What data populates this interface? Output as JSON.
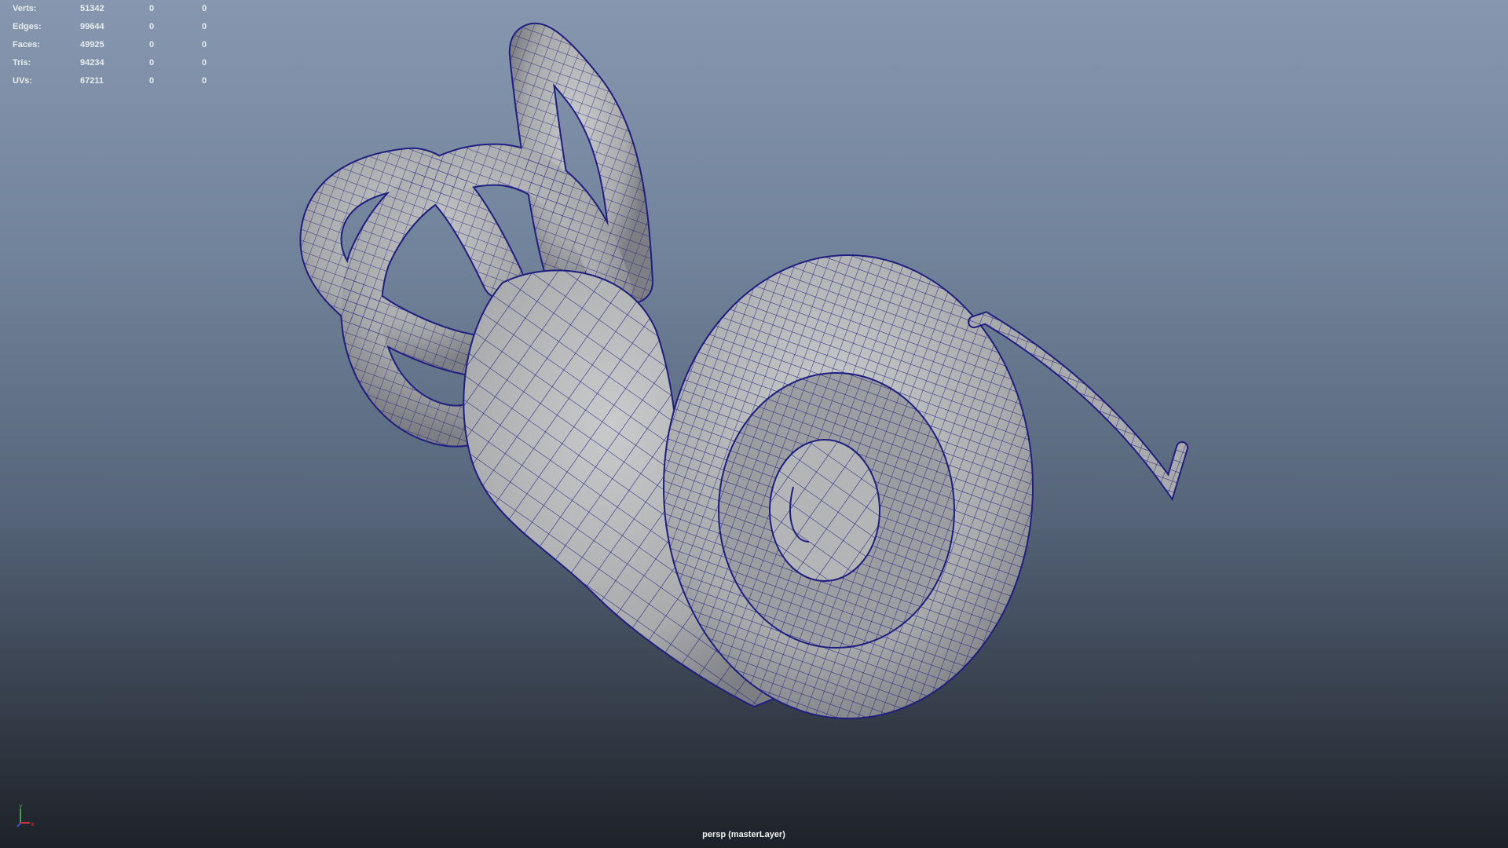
{
  "hud": {
    "rows": [
      {
        "label": "Verts:",
        "value": "51342",
        "selected": "0",
        "triangles": "0"
      },
      {
        "label": "Edges:",
        "value": "99644",
        "selected": "0",
        "triangles": "0"
      },
      {
        "label": "Faces:",
        "value": "49925",
        "selected": "0",
        "triangles": "0"
      },
      {
        "label": "Tris:",
        "value": "94234",
        "selected": "0",
        "triangles": "0"
      },
      {
        "label": "UVs:",
        "value": "67211",
        "selected": "0",
        "triangles": "0"
      }
    ]
  },
  "viewport": {
    "camera_label": "persp (masterLayer)"
  },
  "axis_gizmo": {
    "x_label": "x",
    "y_label": "y"
  },
  "colors": {
    "background_top": "#8697af",
    "background_bottom": "#1d2128",
    "mesh_fill": "#b1b2b4",
    "wireframe": "#1e1e80",
    "hud_text": "#e8ecf0"
  }
}
